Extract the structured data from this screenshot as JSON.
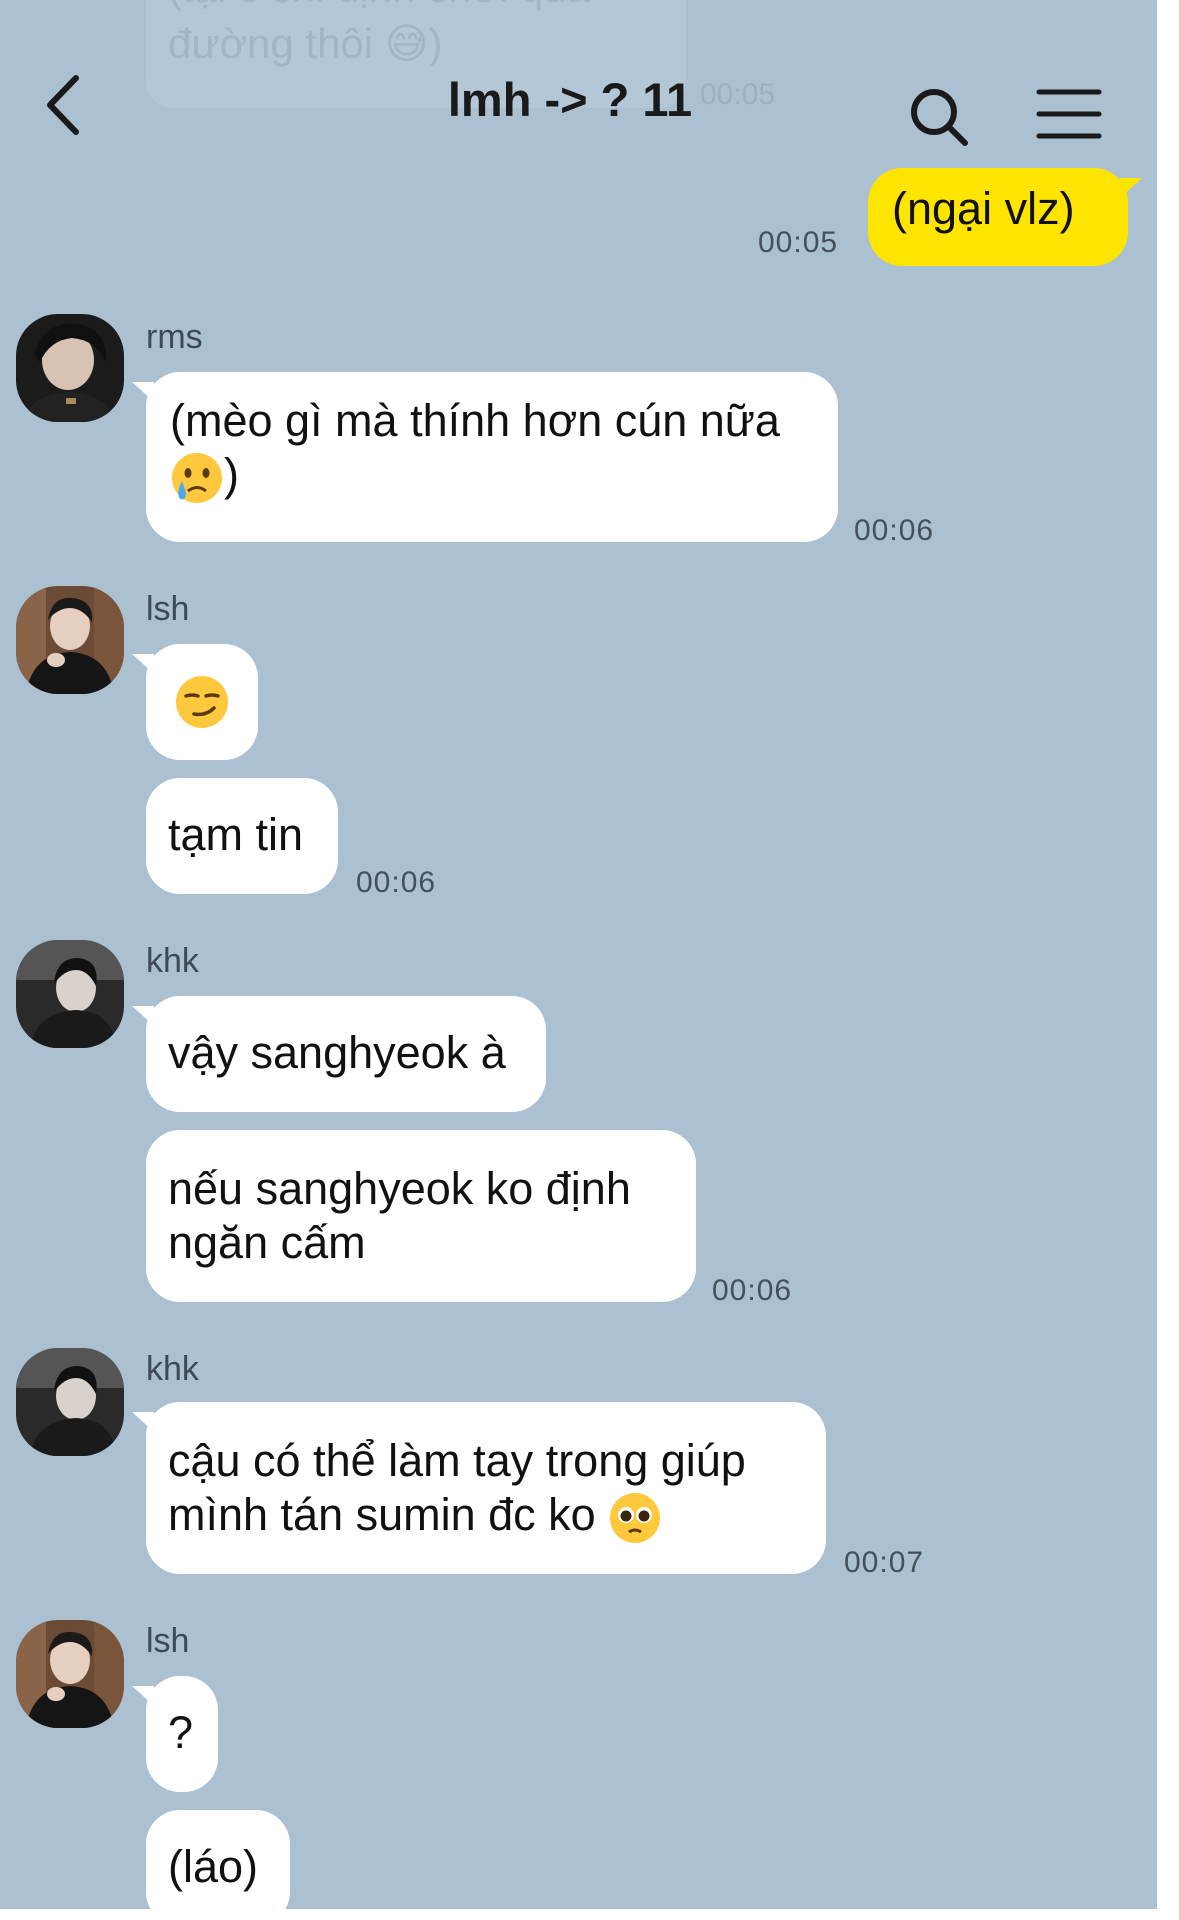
{
  "header": {
    "title": "lmh -> ? 11",
    "back_icon": "chevron-left-icon",
    "search_icon": "search-icon",
    "menu_icon": "hamburger-menu-icon"
  },
  "faded_message": {
    "line1": "(tại c chỉ định chơi qua",
    "line2": "đường thôi 😅)",
    "time": "00:05"
  },
  "colors": {
    "chat_background": "#abc1d2",
    "own_bubble": "#fee500",
    "other_bubble": "#ffffff"
  },
  "messages": [
    {
      "direction": "out",
      "text": "(ngại vlz)",
      "time": "00:05"
    },
    {
      "direction": "in",
      "sender": "rms",
      "lines": [
        "(mèo gì mà thính hơn cún nữa",
        ")"
      ],
      "emoji": "crying-face-emoji",
      "time": "00:06"
    },
    {
      "direction": "in",
      "sender": "lsh",
      "emoji": "smirking-face-emoji",
      "text": "tạm tin",
      "time": "00:06"
    },
    {
      "direction": "in",
      "sender": "khk",
      "text1": "vậy sanghyeok à",
      "lines": [
        "nếu sanghyeok ko định",
        "ngăn cấm"
      ],
      "time": "00:06"
    },
    {
      "direction": "in",
      "sender": "khk",
      "lines": [
        "cậu có thể làm tay trong giúp",
        "mình tán sumin đc ko"
      ],
      "emoji": "pleading-face-emoji",
      "time": "00:07"
    },
    {
      "direction": "in",
      "sender": "lsh",
      "text1": "?",
      "text2": "(láo)"
    }
  ]
}
